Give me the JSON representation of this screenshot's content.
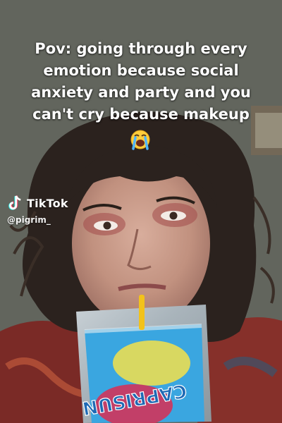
{
  "caption": {
    "lines": [
      "Pov: going through every",
      "emotion because social",
      "anxiety and party and you",
      "can't cry because makeup"
    ],
    "emoji": "loudly-crying-face-emoji"
  },
  "watermark": {
    "brand": "TikTok",
    "handle": "@pigrim_",
    "icon": "tiktok-logo-icon"
  },
  "pouch": {
    "label": "CAPRISUN"
  },
  "colors": {
    "caption_text": "#ffffff",
    "background": "#5f6259",
    "hair": "#2a211d",
    "skin": "#c79a8a",
    "pouch_blue": "#3aa6e0",
    "straw": "#f2c21a",
    "shirt_red": "#8a2a24"
  }
}
